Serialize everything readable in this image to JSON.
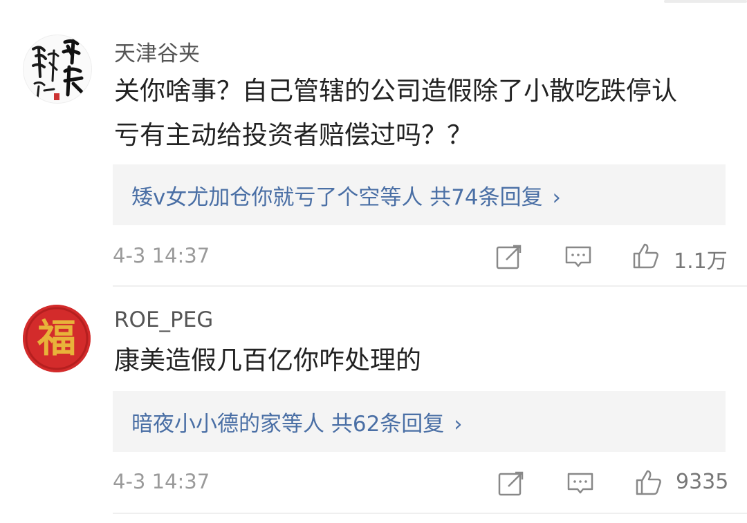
{
  "comments": [
    {
      "username": "天津谷夹",
      "avatar_icon": "calligraphy-avatar-icon",
      "text_line1": "关你啥事？自己管辖的公司造假除了小散吃跌停认",
      "text_line2": "亏有主动给投资者赔偿过吗？？",
      "replies_text": "矮v女尤加仓你就亏了个空等人 共74条回复",
      "replies_chevron": "›",
      "time": "4-3 14:37",
      "likes": "1.1万"
    },
    {
      "username": "ROE_PEG",
      "avatar_icon": "fu-character-avatar-icon",
      "avatar_char": "福",
      "text_line1": "康美造假几百亿你咋处理的",
      "replies_text": "暗夜小小德的家等人 共62条回复",
      "replies_chevron": "›",
      "time": "4-3 14:37",
      "likes": "9335"
    }
  ],
  "colors": {
    "link_blue": "#4a6fa5",
    "reply_bg": "#f4f4f4",
    "meta_gray": "#9a9a9a",
    "avatar_red": "#d32b2b",
    "avatar_gold": "#e8b23a"
  }
}
